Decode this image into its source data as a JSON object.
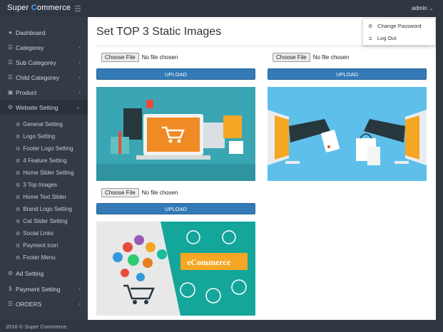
{
  "brand": {
    "pre": "Super ",
    "c": "C",
    "post": "ommerce"
  },
  "header": {
    "user": "admin"
  },
  "user_menu": [
    {
      "label": "Change Password",
      "icon": "gears-icon"
    },
    {
      "label": "Log Out",
      "icon": "logout-icon"
    }
  ],
  "sidebar": {
    "items": [
      {
        "label": "Dashboard",
        "icon": "dashboard-icon"
      },
      {
        "label": "Categorey",
        "icon": "list-icon"
      },
      {
        "label": "Sub Categorey",
        "icon": "list-icon"
      },
      {
        "label": "Child Categorey",
        "icon": "list-icon"
      },
      {
        "label": "Product",
        "icon": "cart-icon"
      },
      {
        "label": "Website Setting",
        "icon": "gears-icon"
      }
    ],
    "subitems": [
      "General Setting",
      "Logo Setting",
      "Footer Logo Setting",
      "4 Feature Setting",
      "Home Slider Setting",
      "3 Top Images",
      "Home Text Slider",
      "Brand Logo Setting",
      "Cat Slider Setting",
      "Social Links",
      "Payment Icon",
      "Footer Menu"
    ],
    "bottom": [
      {
        "label": "Ad Setting",
        "icon": "gears-icon"
      },
      {
        "label": "Payment Setting",
        "icon": "dollar-icon"
      },
      {
        "label": "ORDERS",
        "icon": "list-icon"
      }
    ]
  },
  "main": {
    "title": "Set TOP 3 Static Images",
    "file_button": "Choose File",
    "file_status": "No file chosen",
    "upload_label": "UPLOAD",
    "banner_text": "eCommerce"
  },
  "footer": {
    "text": "2016 © Super Commerce."
  }
}
